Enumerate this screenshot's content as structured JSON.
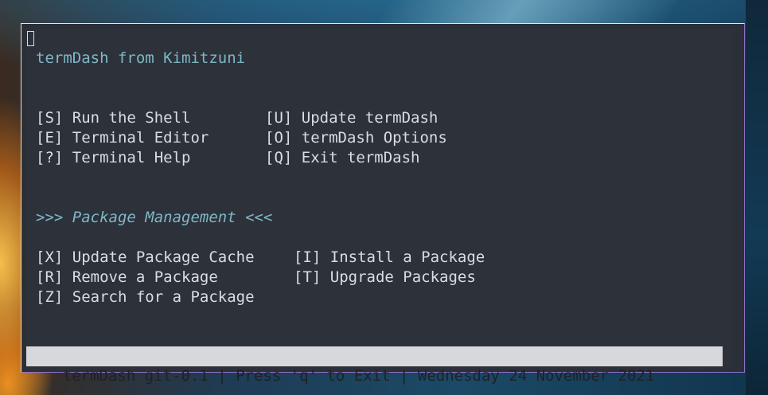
{
  "header": {
    "title": "termDash from Kimitzuni"
  },
  "main_menu": {
    "left": [
      {
        "key": "[S]",
        "label": "Run the Shell"
      },
      {
        "key": "[E]",
        "label": "Terminal Editor"
      },
      {
        "key": "[?]",
        "label": "Terminal Help"
      }
    ],
    "right": [
      {
        "key": "[U]",
        "label": "Update termDash"
      },
      {
        "key": "[O]",
        "label": "termDash Options"
      },
      {
        "key": "[Q]",
        "label": "Exit termDash"
      }
    ]
  },
  "package_section": {
    "heading": ">>> Package Management <<<",
    "left": [
      {
        "key": "[X]",
        "label": "Update Package Cache"
      },
      {
        "key": "[R]",
        "label": "Remove a Package"
      },
      {
        "key": "[Z]",
        "label": "Search for a Package"
      }
    ],
    "right": [
      {
        "key": "[I]",
        "label": "Install a Package"
      },
      {
        "key": "[T]",
        "label": "Upgrade Packages"
      }
    ]
  },
  "status_bar": {
    "text": "termDash git-0.1 | Press 'q' to Exit | Wednesday 24 November 2021"
  },
  "colors": {
    "terminal_bg": "#2d313a",
    "accent": "#7fb7c6",
    "text": "#d9dde3",
    "status_bg": "#d7d8dc"
  }
}
